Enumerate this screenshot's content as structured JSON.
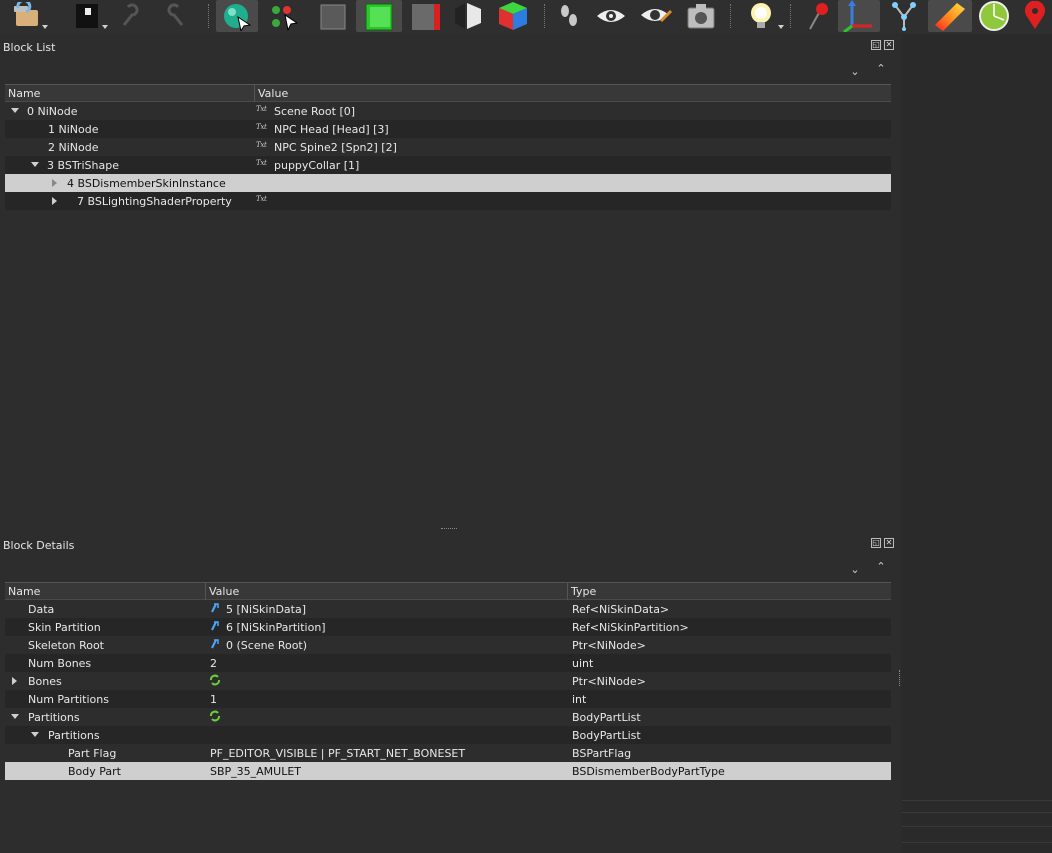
{
  "block_list": {
    "title": "Block List",
    "columns": [
      "Name",
      "Value"
    ],
    "rows": [
      {
        "name": "0 NiNode",
        "value": "Scene Root [0]",
        "txt": "Txt"
      },
      {
        "name": "1 NiNode",
        "value": "NPC Head [Head] [3]",
        "txt": "Txt"
      },
      {
        "name": "2 NiNode",
        "value": "NPC Spine2 [Spn2] [2]",
        "txt": "Txt"
      },
      {
        "name": "3 BSTriShape",
        "value": "puppyCollar [1]",
        "txt": "Txt"
      },
      {
        "name": "4 BSDismemberSkinInstance",
        "value": "",
        "txt": ""
      },
      {
        "name": "7 BSLightingShaderProperty",
        "value": "",
        "txt": "Txt"
      }
    ]
  },
  "block_details": {
    "title": "Block Details",
    "columns": [
      "Name",
      "Value",
      "Type"
    ],
    "rows": [
      {
        "name": "Data",
        "value": "5 [NiSkinData]",
        "type": "Ref<NiSkinData>"
      },
      {
        "name": "Skin Partition",
        "value": "6 [NiSkinPartition]",
        "type": "Ref<NiSkinPartition>"
      },
      {
        "name": "Skeleton Root",
        "value": "0 (Scene Root)",
        "type": "Ptr<NiNode>"
      },
      {
        "name": "Num Bones",
        "value": "2",
        "type": "uint"
      },
      {
        "name": "Bones",
        "value": "",
        "type": "Ptr<NiNode>"
      },
      {
        "name": "Num Partitions",
        "value": "1",
        "type": "int"
      },
      {
        "name": "Partitions",
        "value": "",
        "type": "BodyPartList"
      },
      {
        "name": "Partitions",
        "value": "",
        "type": "BodyPartList"
      },
      {
        "name": "Part Flag",
        "value": "PF_EDITOR_VISIBLE | PF_START_NET_BONESET",
        "type": "BSPartFlag"
      },
      {
        "name": "Body Part",
        "value": "SBP_35_AMULET",
        "type": "BSDismemberBodyPartType"
      }
    ]
  },
  "colors": {
    "background": "#2d2d2d",
    "alt_row": "#262626",
    "selected_row": "#cfcfcf",
    "ref_icon": "#4aa8ff",
    "array_icon": "#6ad13a"
  },
  "icons": {
    "toolbar": [
      "load-icon",
      "save-icon",
      "undo-icon",
      "redo-icon",
      "sphere-select-icon",
      "nodes-icon",
      "box-outline-icon",
      "box-green-icon",
      "box-red-icon",
      "box-shaded-icon",
      "box-colored-icon",
      "footprints-icon",
      "eye-icon",
      "eye-edit-icon",
      "camera-icon",
      "light-bulb-icon",
      "pin-icon",
      "axes-icon",
      "skeleton-icon",
      "texture-icon",
      "globe-icon",
      "map-marker-icon"
    ]
  }
}
